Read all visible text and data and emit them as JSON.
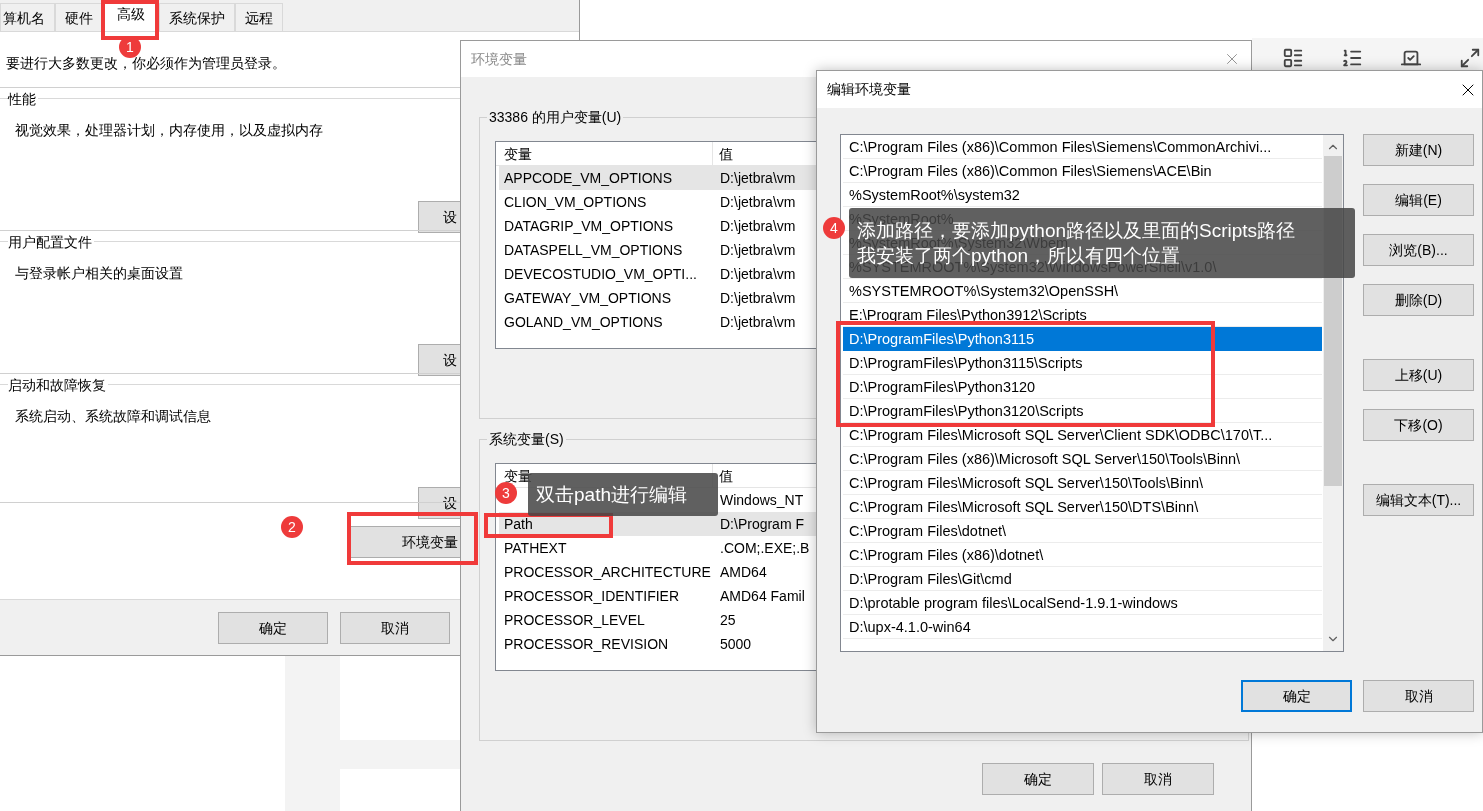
{
  "system_properties": {
    "tabs": [
      {
        "label": "算机名",
        "selected": false
      },
      {
        "label": "硬件",
        "selected": false
      },
      {
        "label": "高级",
        "selected": true
      },
      {
        "label": "系统保护",
        "selected": false
      },
      {
        "label": "远程",
        "selected": false
      }
    ],
    "notice": "要进行大多数更改，你必须作为管理员登录。",
    "sections": [
      {
        "title": "性能",
        "description": "视觉效果，处理器计划，内存使用，以及虚拟内存",
        "button": "设"
      },
      {
        "title": "用户配置文件",
        "description": "与登录帐户相关的桌面设置",
        "button": "设"
      },
      {
        "title": "启动和故障恢复",
        "description": "系统启动、系统故障和调试信息",
        "button": "设"
      }
    ],
    "env_button": "环境变量",
    "buttons": [
      "确定",
      "取消"
    ]
  },
  "environment_variables": {
    "title": "环境变量",
    "user_group": {
      "title": "33386 的用户变量(U)",
      "columns": [
        "变量",
        "值"
      ],
      "rows": [
        {
          "name": "APPCODE_VM_OPTIONS",
          "value": "D:\\jetbra\\vm",
          "selected": true
        },
        {
          "name": "CLION_VM_OPTIONS",
          "value": "D:\\jetbra\\vm",
          "selected": false
        },
        {
          "name": "DATAGRIP_VM_OPTIONS",
          "value": "D:\\jetbra\\vm",
          "selected": false
        },
        {
          "name": "DATASPELL_VM_OPTIONS",
          "value": "D:\\jetbra\\vm",
          "selected": false
        },
        {
          "name": "DEVECOSTUDIO_VM_OPTI...",
          "value": "D:\\jetbra\\vm",
          "selected": false
        },
        {
          "name": "GATEWAY_VM_OPTIONS",
          "value": "D:\\jetbra\\vm",
          "selected": false
        },
        {
          "name": "GOLAND_VM_OPTIONS",
          "value": "D:\\jetbra\\vm",
          "selected": false
        }
      ]
    },
    "system_group": {
      "title": "系统变量(S)",
      "columns": [
        "变量",
        "值"
      ],
      "rows": [
        {
          "value": "Windows_NT",
          "selected": false
        },
        {
          "name": "Path",
          "value": "D:\\Program F",
          "selected": true
        },
        {
          "name": "PATHEXT",
          "value": ".COM;.EXE;.B",
          "selected": false
        },
        {
          "name": "PROCESSOR_ARCHITECTURE",
          "value": "AMD64",
          "selected": false
        },
        {
          "name": "PROCESSOR_IDENTIFIER",
          "value": "AMD64 Famil",
          "selected": false
        },
        {
          "name": "PROCESSOR_LEVEL",
          "value": "25",
          "selected": false
        },
        {
          "name": "PROCESSOR_REVISION",
          "value": "5000",
          "selected": false
        }
      ]
    },
    "buttons": [
      "确定",
      "取消"
    ]
  },
  "edit_variable": {
    "title": "编辑环境变量",
    "paths": [
      {
        "text": "C:\\Program Files (x86)\\Common Files\\Siemens\\CommonArchivi...",
        "selected": false
      },
      {
        "text": "C:\\Program Files (x86)\\Common Files\\Siemens\\ACE\\Bin",
        "selected": false
      },
      {
        "text": "%SystemRoot%\\system32",
        "selected": false
      },
      {
        "text": "%SystemRoot%",
        "selected": false
      },
      {
        "text": "%SystemRoot%\\System32\\Wbem",
        "selected": false
      },
      {
        "text": "%SYSTEMROOT%\\System32\\WindowsPowerShell\\v1.0\\",
        "selected": false
      },
      {
        "text": "%SYSTEMROOT%\\System32\\OpenSSH\\",
        "selected": false
      },
      {
        "text": "E:\\Program Files\\Python3912\\Scripts",
        "selected": false
      },
      {
        "text": "D:\\ProgramFiles\\Python3115",
        "selected": true
      },
      {
        "text": "D:\\ProgramFiles\\Python3115\\Scripts",
        "selected": false
      },
      {
        "text": "D:\\ProgramFiles\\Python3120",
        "selected": false
      },
      {
        "text": "D:\\ProgramFiles\\Python3120\\Scripts",
        "selected": false
      },
      {
        "text": "C:\\Program Files\\Microsoft SQL Server\\Client SDK\\ODBC\\170\\T...",
        "selected": false
      },
      {
        "text": "C:\\Program Files (x86)\\Microsoft SQL Server\\150\\Tools\\Binn\\",
        "selected": false
      },
      {
        "text": "C:\\Program Files\\Microsoft SQL Server\\150\\Tools\\Binn\\",
        "selected": false
      },
      {
        "text": "C:\\Program Files\\Microsoft SQL Server\\150\\DTS\\Binn\\",
        "selected": false
      },
      {
        "text": "C:\\Program Files\\dotnet\\",
        "selected": false
      },
      {
        "text": "C:\\Program Files (x86)\\dotnet\\",
        "selected": false
      },
      {
        "text": "D:\\Program Files\\Git\\cmd",
        "selected": false
      },
      {
        "text": "D:\\protable program files\\LocalSend-1.9.1-windows",
        "selected": false
      },
      {
        "text": "D:\\upx-4.1.0-win64",
        "selected": false
      }
    ],
    "side_buttons": [
      {
        "label": "新建(N)"
      },
      {
        "label": "编辑(E)"
      },
      {
        "label": "浏览(B)..."
      },
      {
        "label": "删除(D)"
      },
      {
        "label": "上移(U)"
      },
      {
        "label": "下移(O)"
      },
      {
        "label": "编辑文本(T)..."
      }
    ],
    "buttons": [
      {
        "label": "确定",
        "default": true
      },
      {
        "label": "取消",
        "default": false
      }
    ]
  },
  "annotations": [
    {
      "kind": "box"
    },
    {
      "kind": "badge",
      "label": "1"
    },
    {
      "kind": "box"
    },
    {
      "kind": "badge",
      "label": "2"
    },
    {
      "kind": "box"
    },
    {
      "kind": "tooltip",
      "label": "3",
      "lines": [
        "双击path进行编辑"
      ]
    },
    {
      "kind": "box"
    },
    {
      "kind": "tooltip",
      "label": "4",
      "lines": [
        "添加路径，要添加python路径以及里面的Scripts路径",
        "我安装了两个python，所以有四个位置"
      ]
    }
  ]
}
